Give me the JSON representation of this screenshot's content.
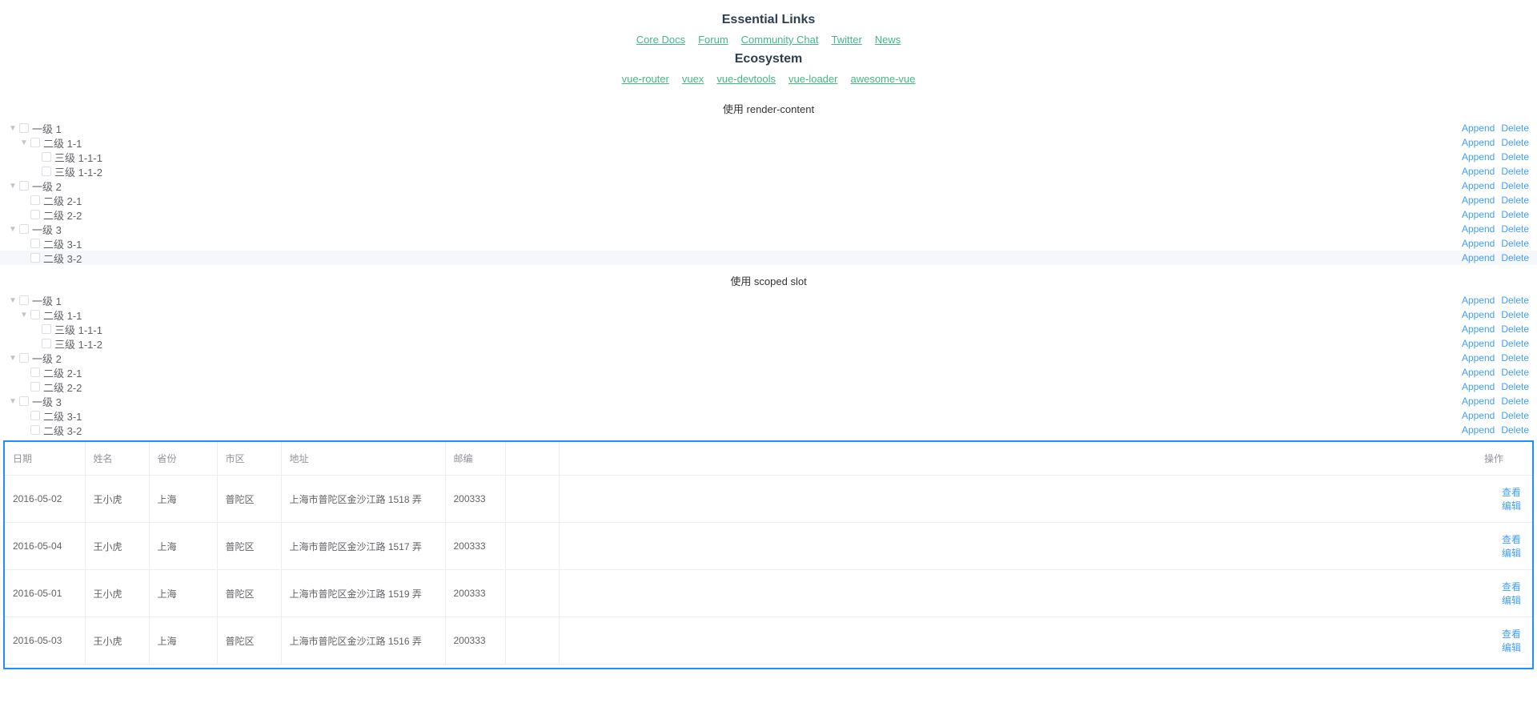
{
  "header": {
    "essentialLinksTitle": "Essential Links",
    "essentialLinks": [
      "Core Docs",
      "Forum",
      "Community Chat",
      "Twitter",
      "News"
    ],
    "ecosystemTitle": "Ecosystem",
    "ecosystemLinks": [
      "vue-router",
      "vuex",
      "vue-devtools",
      "vue-loader",
      "awesome-vue"
    ]
  },
  "section1": {
    "title": "使用 render-content"
  },
  "section2": {
    "title": "使用 scoped slot"
  },
  "treeActions": {
    "append": "Append",
    "delete": "Delete"
  },
  "tree1": [
    {
      "indent": 0,
      "expanded": true,
      "hasChildren": true,
      "label": "一级 1"
    },
    {
      "indent": 1,
      "expanded": true,
      "hasChildren": true,
      "label": "二级 1-1"
    },
    {
      "indent": 2,
      "expanded": false,
      "hasChildren": false,
      "label": "三级 1-1-1"
    },
    {
      "indent": 2,
      "expanded": false,
      "hasChildren": false,
      "label": "三级 1-1-2"
    },
    {
      "indent": 0,
      "expanded": true,
      "hasChildren": true,
      "label": "一级 2"
    },
    {
      "indent": 1,
      "expanded": false,
      "hasChildren": false,
      "label": "二级 2-1"
    },
    {
      "indent": 1,
      "expanded": false,
      "hasChildren": false,
      "label": "二级 2-2"
    },
    {
      "indent": 0,
      "expanded": true,
      "hasChildren": true,
      "label": "一级 3"
    },
    {
      "indent": 1,
      "expanded": false,
      "hasChildren": false,
      "label": "二级 3-1"
    },
    {
      "indent": 1,
      "expanded": false,
      "hasChildren": false,
      "label": "二级 3-2",
      "highlight": true
    }
  ],
  "tree2": [
    {
      "indent": 0,
      "expanded": true,
      "hasChildren": true,
      "label": "一级 1"
    },
    {
      "indent": 1,
      "expanded": true,
      "hasChildren": true,
      "label": "二级 1-1"
    },
    {
      "indent": 2,
      "expanded": false,
      "hasChildren": false,
      "label": "三级 1-1-1"
    },
    {
      "indent": 2,
      "expanded": false,
      "hasChildren": false,
      "label": "三级 1-1-2"
    },
    {
      "indent": 0,
      "expanded": true,
      "hasChildren": true,
      "label": "一级 2"
    },
    {
      "indent": 1,
      "expanded": false,
      "hasChildren": false,
      "label": "二级 2-1"
    },
    {
      "indent": 1,
      "expanded": false,
      "hasChildren": false,
      "label": "二级 2-2"
    },
    {
      "indent": 0,
      "expanded": true,
      "hasChildren": true,
      "label": "一级 3"
    },
    {
      "indent": 1,
      "expanded": false,
      "hasChildren": false,
      "label": "二级 3-1"
    },
    {
      "indent": 1,
      "expanded": false,
      "hasChildren": false,
      "label": "二级 3-2"
    }
  ],
  "table": {
    "headers": {
      "date": "日期",
      "name": "姓名",
      "province": "省份",
      "city": "市区",
      "address": "地址",
      "zip": "邮编",
      "actions": "操作"
    },
    "rowActions": {
      "view": "查看",
      "edit": "编辑"
    },
    "rows": [
      {
        "date": "2016-05-02",
        "name": "王小虎",
        "province": "上海",
        "city": "普陀区",
        "address": "上海市普陀区金沙江路 1518 弄",
        "zip": "200333"
      },
      {
        "date": "2016-05-04",
        "name": "王小虎",
        "province": "上海",
        "city": "普陀区",
        "address": "上海市普陀区金沙江路 1517 弄",
        "zip": "200333"
      },
      {
        "date": "2016-05-01",
        "name": "王小虎",
        "province": "上海",
        "city": "普陀区",
        "address": "上海市普陀区金沙江路 1519 弄",
        "zip": "200333"
      },
      {
        "date": "2016-05-03",
        "name": "王小虎",
        "province": "上海",
        "city": "普陀区",
        "address": "上海市普陀区金沙江路 1516 弄",
        "zip": "200333"
      }
    ]
  }
}
